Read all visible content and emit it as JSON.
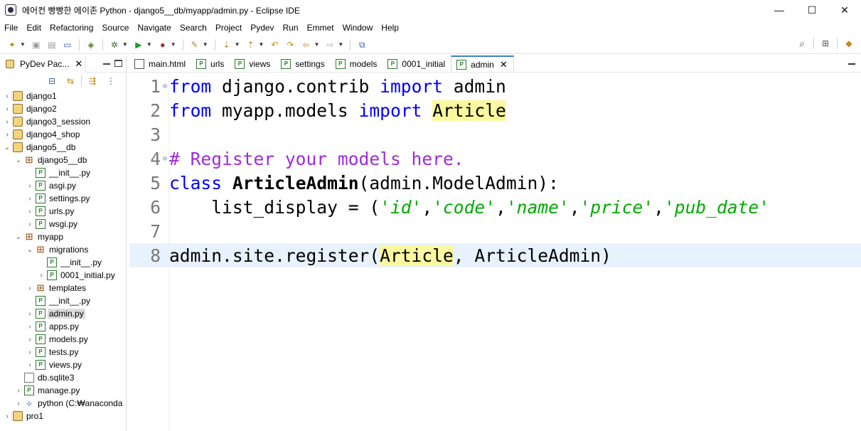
{
  "window": {
    "title": "에어컨 빵빵한 에이존 Python - django5__db/myapp/admin.py - Eclipse IDE",
    "controls": [
      "—",
      "☐",
      "✕"
    ]
  },
  "menubar": [
    "File",
    "Edit",
    "Refactoring",
    "Source",
    "Navigate",
    "Search",
    "Project",
    "Pydev",
    "Run",
    "Emmet",
    "Window",
    "Help"
  ],
  "package_explorer": {
    "tab_label": "PyDev Pac...",
    "tree": [
      {
        "label": "django1",
        "indent": 0,
        "chev": "›",
        "icon": "proj"
      },
      {
        "label": "django2",
        "indent": 0,
        "chev": "›",
        "icon": "proj"
      },
      {
        "label": "django3_session",
        "indent": 0,
        "chev": "›",
        "icon": "proj"
      },
      {
        "label": "django4_shop",
        "indent": 0,
        "chev": "›",
        "icon": "proj"
      },
      {
        "label": "django5__db",
        "indent": 0,
        "chev": "⌄",
        "icon": "proj"
      },
      {
        "label": "django5__db",
        "indent": 1,
        "chev": "⌄",
        "icon": "pkg"
      },
      {
        "label": "__init__.py",
        "indent": 2,
        "chev": "",
        "icon": "py"
      },
      {
        "label": "asgi.py",
        "indent": 2,
        "chev": "›",
        "icon": "py"
      },
      {
        "label": "settings.py",
        "indent": 2,
        "chev": "›",
        "icon": "py"
      },
      {
        "label": "urls.py",
        "indent": 2,
        "chev": "›",
        "icon": "py"
      },
      {
        "label": "wsgi.py",
        "indent": 2,
        "chev": "›",
        "icon": "py"
      },
      {
        "label": "myapp",
        "indent": 1,
        "chev": "⌄",
        "icon": "pkg"
      },
      {
        "label": "migrations",
        "indent": 2,
        "chev": "⌄",
        "icon": "pkg"
      },
      {
        "label": "__init__.py",
        "indent": 3,
        "chev": "",
        "icon": "py"
      },
      {
        "label": "0001_initial.py",
        "indent": 3,
        "chev": "›",
        "icon": "py"
      },
      {
        "label": "templates",
        "indent": 2,
        "chev": "›",
        "icon": "pkg"
      },
      {
        "label": "__init__.py",
        "indent": 2,
        "chev": "",
        "icon": "py"
      },
      {
        "label": "admin.py",
        "indent": 2,
        "chev": "›",
        "icon": "py",
        "selected": true
      },
      {
        "label": "apps.py",
        "indent": 2,
        "chev": "›",
        "icon": "py"
      },
      {
        "label": "models.py",
        "indent": 2,
        "chev": "›",
        "icon": "py"
      },
      {
        "label": "tests.py",
        "indent": 2,
        "chev": "›",
        "icon": "py"
      },
      {
        "label": "views.py",
        "indent": 2,
        "chev": "›",
        "icon": "py"
      },
      {
        "label": "db.sqlite3",
        "indent": 1,
        "chev": "",
        "icon": "file"
      },
      {
        "label": "manage.py",
        "indent": 1,
        "chev": "›",
        "icon": "py"
      },
      {
        "label": "python  (C:₩anaconda",
        "indent": 1,
        "chev": "›",
        "icon": "python"
      },
      {
        "label": "pro1",
        "indent": 0,
        "chev": "›",
        "icon": "proj"
      }
    ]
  },
  "editor": {
    "tabs": [
      {
        "label": "main.html",
        "icon": "html",
        "active": false
      },
      {
        "label": "urls",
        "icon": "py",
        "active": false
      },
      {
        "label": "views",
        "icon": "py",
        "active": false
      },
      {
        "label": "settings",
        "icon": "py",
        "active": false
      },
      {
        "label": "models",
        "icon": "py",
        "active": false
      },
      {
        "label": "0001_initial",
        "icon": "py",
        "active": false
      },
      {
        "label": "admin",
        "icon": "py",
        "active": true
      }
    ],
    "lines": [
      {
        "n": "1",
        "fold": "⊖",
        "tokens": [
          [
            "kw",
            "from"
          ],
          [
            "code",
            " django.contrib "
          ],
          [
            "kw",
            "import"
          ],
          [
            "code",
            " admin"
          ]
        ]
      },
      {
        "n": "2",
        "fold": "",
        "tokens": [
          [
            "kw",
            "from"
          ],
          [
            "code",
            " myapp.models "
          ],
          [
            "kw",
            "import"
          ],
          [
            "code",
            " "
          ],
          [
            "hl",
            "Article"
          ]
        ]
      },
      {
        "n": "3",
        "fold": "",
        "tokens": []
      },
      {
        "n": "4",
        "fold": "⊖",
        "tokens": [
          [
            "comment",
            "# Register your models here."
          ]
        ]
      },
      {
        "n": "5",
        "fold": "",
        "tokens": [
          [
            "kw",
            "class"
          ],
          [
            "code",
            " "
          ],
          [
            "bold",
            "ArticleAdmin"
          ],
          [
            "code",
            "(admin.ModelAdmin):"
          ]
        ]
      },
      {
        "n": "6",
        "fold": "",
        "tokens": [
          [
            "code",
            "    list_display = ("
          ],
          [
            "str",
            "'id'"
          ],
          [
            "code",
            ","
          ],
          [
            "str",
            "'code'"
          ],
          [
            "code",
            ","
          ],
          [
            "str",
            "'name'"
          ],
          [
            "code",
            ","
          ],
          [
            "str",
            "'price'"
          ],
          [
            "code",
            ","
          ],
          [
            "str",
            "'pub_date'"
          ]
        ]
      },
      {
        "n": "7",
        "fold": "",
        "tokens": []
      },
      {
        "n": "8",
        "fold": "",
        "current": true,
        "tokens": [
          [
            "code",
            "admin.site.register("
          ],
          [
            "hl",
            "Article"
          ],
          [
            "code",
            ", ArticleAdmin)"
          ]
        ]
      }
    ]
  }
}
